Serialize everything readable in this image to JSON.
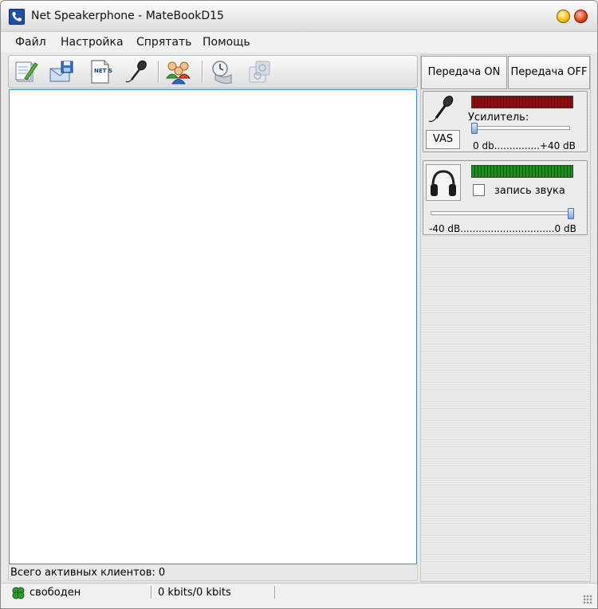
{
  "window": {
    "title": "Net Speakerphone - MateBookD15"
  },
  "menu": {
    "items": [
      "Файл",
      "Настройка",
      "Спрятать",
      "Помощь"
    ]
  },
  "toolbar": {
    "buttons": [
      {
        "icon": "notepad-pen-icon"
      },
      {
        "icon": "mail-floppy-icon"
      },
      {
        "icon": "net-send-icon",
        "text": "NET SEND"
      },
      {
        "icon": "microphone-icon"
      },
      {
        "icon": "users-group-icon"
      },
      {
        "icon": "clock-schedule-icon"
      },
      {
        "icon": "settings-disabled-icon"
      }
    ]
  },
  "clients": {
    "status_label": "Всего активных клиентов: 0"
  },
  "transmit": {
    "on_label": "Передача ON",
    "off_label": "Передача OFF"
  },
  "mic_panel": {
    "gain_label": "Усилитель:",
    "scale_label": "0 db...............+40 dB",
    "vas_label": "VAS",
    "gain_value": 0
  },
  "speaker_panel": {
    "record_label": "запись звука",
    "record_checked": false,
    "scale_label": "-40 dB...............................0 dB",
    "volume_value": 1.0
  },
  "statusbar": {
    "state": "свободен",
    "bitrate": "0 kbits/0 kbits"
  },
  "colors": {
    "meter_red": "#8c1010",
    "meter_green": "#1e8f1e",
    "list_border": "#3f8fd0"
  }
}
